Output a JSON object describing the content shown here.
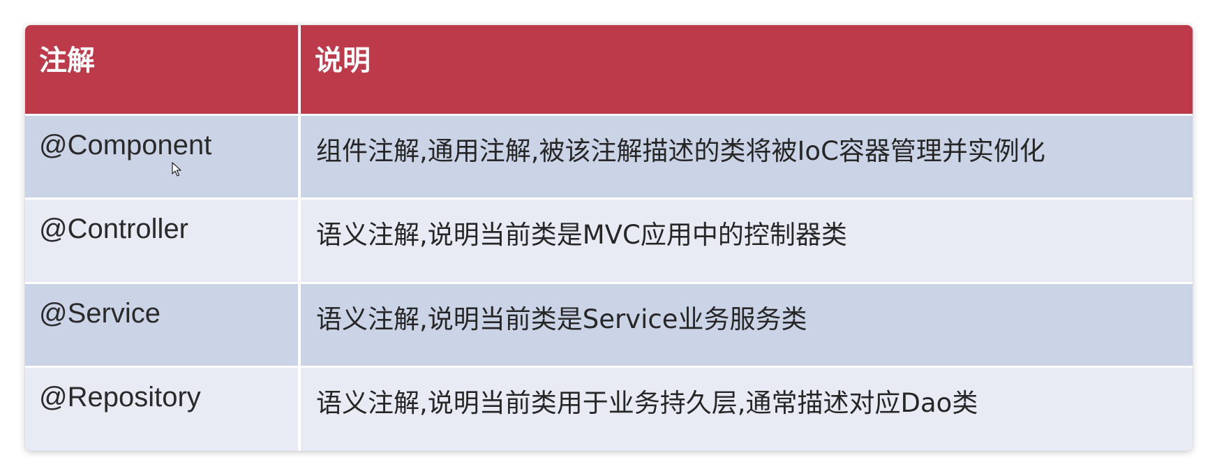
{
  "table": {
    "headers": [
      "注解",
      "说明"
    ],
    "rows": [
      {
        "annotation": "@Component",
        "description": "组件注解,通用注解,被该注解描述的类将被IoC容器管理并实例化"
      },
      {
        "annotation": "@Controller",
        "description": "语义注解,说明当前类是MVC应用中的控制器类"
      },
      {
        "annotation": "@Service",
        "description": "语义注解,说明当前类是Service业务服务类"
      },
      {
        "annotation": "@Repository",
        "description": "语义注解,说明当前类用于业务持久层,通常描述对应Dao类"
      }
    ]
  },
  "colors": {
    "header_bg": "#bd3a4b",
    "row_odd_bg": "#cbd3e6",
    "row_even_bg": "#e8ebf4"
  },
  "icons": {
    "cursor": "mouse-pointer-icon"
  }
}
